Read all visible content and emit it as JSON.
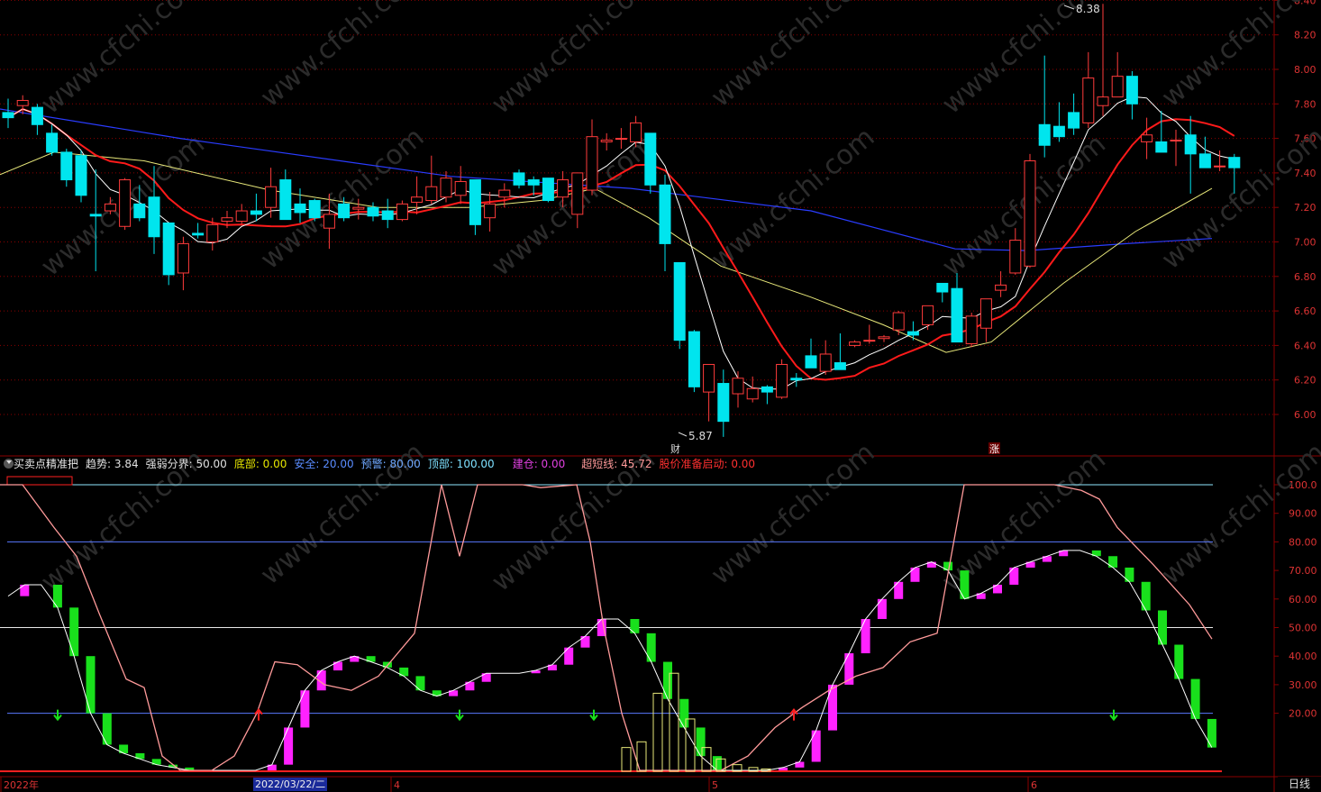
{
  "price_panel": {
    "y_ticks": [
      "8.40",
      "8.20",
      "8.00",
      "7.80",
      "7.60",
      "7.40",
      "7.20",
      "7.00",
      "6.80",
      "6.60",
      "6.40",
      "6.20",
      "6.00"
    ],
    "high_label": "8.38",
    "low_label": "5.87",
    "marker_cai": "财",
    "marker_zhang": "涨"
  },
  "indicator_bar": {
    "name": "买卖点精准把",
    "items": [
      {
        "label": "趋势:",
        "value": "3.84",
        "color": "#e0e0e0"
      },
      {
        "label": "强弱分界:",
        "value": "50.00",
        "color": "#e0e0e0"
      },
      {
        "label": "底部:",
        "value": "0.00",
        "color": "#e6e600"
      },
      {
        "label": "安全:",
        "value": "20.00",
        "color": "#5a8cff"
      },
      {
        "label": "预警:",
        "value": "80.00",
        "color": "#6fa8ff"
      },
      {
        "label": "顶部:",
        "value": "100.00",
        "color": "#7ee0ff"
      },
      {
        "label": "建仓:",
        "value": "0.00",
        "color": "#e040e0"
      },
      {
        "label": "超短线:",
        "value": "45.72",
        "color": "#ff9a9a"
      },
      {
        "label": "股价准备启动:",
        "value": "0.00",
        "color": "#ff3030"
      }
    ]
  },
  "indicator_panel": {
    "y_ticks": [
      "100.0",
      "90.00",
      "80.00",
      "70.00",
      "60.00",
      "50.00",
      "40.00",
      "30.00",
      "20.00"
    ]
  },
  "x_axis": {
    "labels": [
      "2022年",
      "4",
      "5",
      "6"
    ],
    "selected_date": "2022/03/22/二",
    "period": "日线"
  },
  "watermark": "www.cfchi.com",
  "colors": {
    "up": "#ff3b3b",
    "down": "#00e5ee",
    "ma_red": "#ff1a1a",
    "ma_white": "#ffffff",
    "ma_yellow": "#e8e87a",
    "ma_blue": "#2a3cff",
    "grid": "#8b0000"
  },
  "chart_data": {
    "type": "candlestick",
    "candles": [
      [
        7.75,
        7.83,
        7.66,
        7.72
      ],
      [
        7.79,
        7.85,
        7.74,
        7.82
      ],
      [
        7.78,
        7.8,
        7.62,
        7.68
      ],
      [
        7.63,
        7.68,
        7.5,
        7.52
      ],
      [
        7.52,
        7.54,
        7.32,
        7.36
      ],
      [
        7.5,
        7.53,
        7.23,
        7.27
      ],
      [
        7.16,
        7.42,
        6.83,
        7.15
      ],
      [
        7.18,
        7.26,
        7.16,
        7.22
      ],
      [
        7.09,
        7.37,
        7.07,
        7.36
      ],
      [
        7.22,
        7.33,
        7.12,
        7.14
      ],
      [
        7.26,
        7.44,
        6.93,
        7.03
      ],
      [
        7.11,
        7.11,
        6.75,
        6.81
      ],
      [
        6.82,
        7.03,
        6.72,
        6.99
      ],
      [
        7.05,
        7.11,
        7.02,
        7.04
      ],
      [
        7.0,
        7.14,
        6.95,
        7.1
      ],
      [
        7.12,
        7.18,
        7.08,
        7.14
      ],
      [
        7.12,
        7.22,
        7.1,
        7.18
      ],
      [
        7.18,
        7.28,
        7.12,
        7.16
      ],
      [
        7.2,
        7.43,
        7.14,
        7.32
      ],
      [
        7.36,
        7.42,
        7.17,
        7.13
      ],
      [
        7.22,
        7.31,
        7.11,
        7.17
      ],
      [
        7.24,
        7.25,
        7.12,
        7.14
      ],
      [
        7.08,
        7.28,
        6.96,
        7.16
      ],
      [
        7.22,
        7.26,
        7.12,
        7.14
      ],
      [
        7.19,
        7.25,
        7.13,
        7.2
      ],
      [
        7.2,
        7.23,
        7.12,
        7.15
      ],
      [
        7.18,
        7.25,
        7.08,
        7.13
      ],
      [
        7.13,
        7.24,
        7.12,
        7.22
      ],
      [
        7.23,
        7.38,
        7.16,
        7.26
      ],
      [
        7.24,
        7.5,
        7.22,
        7.32
      ],
      [
        7.26,
        7.41,
        7.23,
        7.37
      ],
      [
        7.27,
        7.44,
        7.22,
        7.35
      ],
      [
        7.36,
        7.35,
        7.04,
        7.1
      ],
      [
        7.14,
        7.29,
        7.06,
        7.22
      ],
      [
        7.26,
        7.34,
        7.2,
        7.3
      ],
      [
        7.4,
        7.42,
        7.31,
        7.33
      ],
      [
        7.36,
        7.38,
        7.27,
        7.33
      ],
      [
        7.37,
        7.3,
        7.23,
        7.24
      ],
      [
        7.26,
        7.41,
        7.2,
        7.36
      ],
      [
        7.16,
        7.39,
        7.08,
        7.4
      ],
      [
        7.3,
        7.71,
        7.27,
        7.61
      ],
      [
        7.58,
        7.63,
        7.53,
        7.59
      ],
      [
        7.6,
        7.66,
        7.54,
        7.6
      ],
      [
        7.58,
        7.73,
        7.55,
        7.69
      ],
      [
        7.63,
        7.63,
        7.28,
        7.33
      ],
      [
        7.33,
        7.39,
        6.83,
        6.99
      ],
      [
        6.88,
        6.87,
        6.38,
        6.43
      ],
      [
        6.48,
        6.49,
        6.13,
        6.16
      ],
      [
        6.13,
        6.29,
        5.96,
        6.29
      ],
      [
        6.18,
        6.26,
        5.87,
        5.96
      ],
      [
        6.12,
        6.25,
        6.04,
        6.21
      ],
      [
        6.09,
        6.22,
        6.07,
        6.15
      ],
      [
        6.16,
        6.17,
        6.06,
        6.13
      ],
      [
        6.1,
        6.32,
        6.09,
        6.29
      ],
      [
        6.21,
        6.24,
        6.16,
        6.2
      ],
      [
        6.34,
        6.44,
        6.28,
        6.27
      ],
      [
        6.25,
        6.43,
        6.23,
        6.35
      ],
      [
        6.3,
        6.47,
        6.28,
        6.26
      ],
      [
        6.4,
        6.43,
        6.39,
        6.42
      ],
      [
        6.43,
        6.52,
        6.41,
        6.43
      ],
      [
        6.44,
        6.46,
        6.42,
        6.45
      ],
      [
        6.49,
        6.6,
        6.46,
        6.59
      ],
      [
        6.48,
        6.54,
        6.43,
        6.46
      ],
      [
        6.52,
        6.62,
        6.49,
        6.63
      ],
      [
        6.76,
        6.74,
        6.65,
        6.71
      ],
      [
        6.73,
        6.82,
        6.44,
        6.42
      ],
      [
        6.41,
        6.59,
        6.39,
        6.57
      ],
      [
        6.5,
        6.57,
        6.42,
        6.67
      ],
      [
        6.72,
        6.83,
        6.68,
        6.75
      ],
      [
        6.82,
        7.08,
        6.81,
        7.01
      ],
      [
        6.86,
        7.51,
        6.85,
        7.47
      ],
      [
        7.68,
        8.08,
        7.49,
        7.56
      ],
      [
        7.67,
        7.81,
        7.58,
        7.61
      ],
      [
        7.75,
        7.86,
        7.62,
        7.66
      ],
      [
        7.69,
        8.1,
        7.66,
        7.95
      ],
      [
        7.79,
        8.38,
        7.73,
        7.84
      ],
      [
        7.84,
        8.1,
        7.91,
        7.96
      ],
      [
        7.96,
        7.99,
        7.71,
        7.8
      ],
      [
        7.58,
        7.72,
        7.48,
        7.62
      ],
      [
        7.58,
        7.76,
        7.52,
        7.52
      ],
      [
        7.59,
        7.65,
        7.44,
        7.59
      ],
      [
        7.62,
        7.73,
        7.28,
        7.51
      ],
      [
        7.51,
        7.61,
        7.5,
        7.43
      ],
      [
        7.44,
        7.53,
        7.41,
        7.44
      ],
      [
        7.49,
        7.51,
        7.28,
        7.43
      ]
    ]
  }
}
